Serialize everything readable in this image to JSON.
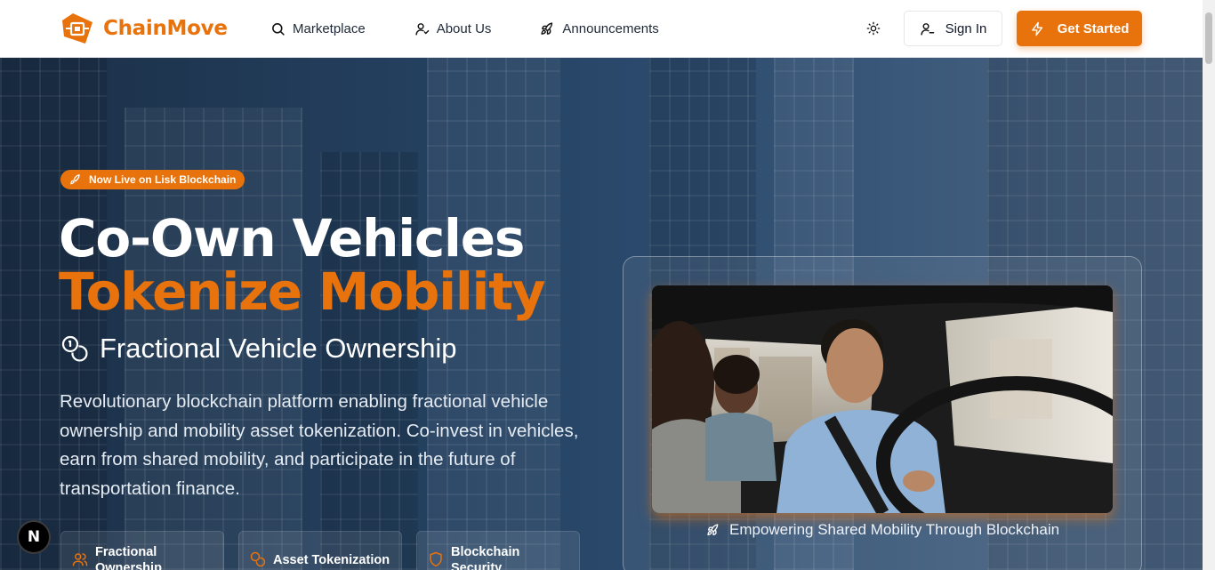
{
  "brand": {
    "name": "ChainMove",
    "accent": "#e8720c"
  },
  "nav": {
    "items": [
      {
        "label": "Marketplace",
        "icon": "search-icon"
      },
      {
        "label": "About Us",
        "icon": "user-icon"
      },
      {
        "label": "Announcements",
        "icon": "rocket-icon"
      }
    ]
  },
  "header": {
    "theme_toggle_icon": "sun-icon",
    "sign_in_label": "Sign In",
    "get_started_label": "Get Started"
  },
  "hero": {
    "badge": "Now Live on Lisk Blockchain",
    "title_line1": "Co-Own Vehicles",
    "title_line2": "Tokenize Mobility",
    "subtitle": "Fractional Vehicle Ownership",
    "description": "Revolutionary blockchain platform enabling fractional vehicle ownership and mobility asset tokenization. Co-invest in vehicles, earn from shared mobility, and participate in the future of transportation finance.",
    "features": [
      {
        "label": "Fractional Ownership",
        "icon": "users-icon"
      },
      {
        "label": "Asset Tokenization",
        "icon": "coins-icon"
      },
      {
        "label": "Blockchain Security",
        "icon": "shield-icon"
      }
    ],
    "media_caption": "Empowering Shared Mobility Through Blockchain"
  },
  "devtools": {
    "badge_letter": "N"
  }
}
